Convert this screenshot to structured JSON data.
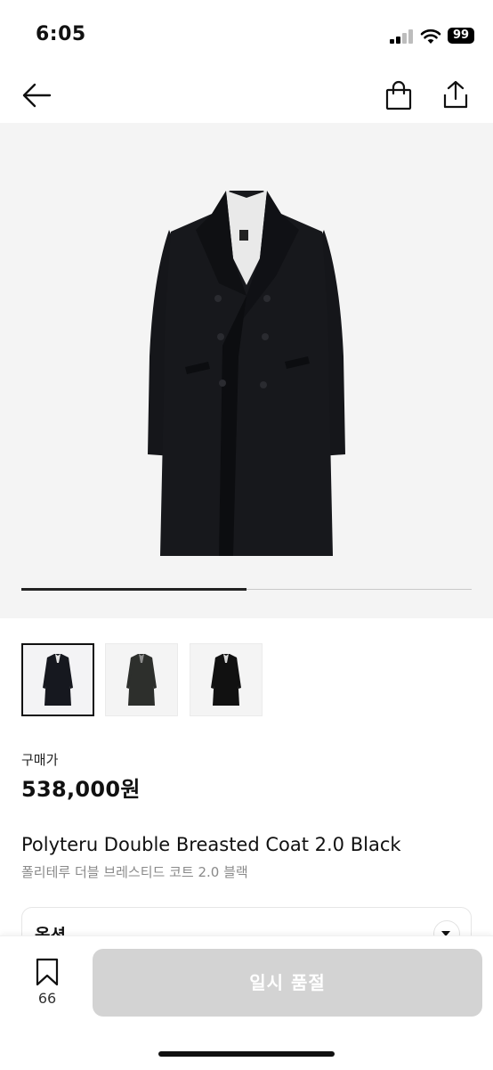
{
  "status_bar": {
    "time": "6:05",
    "battery": "99"
  },
  "nav": {
    "back_icon": "arrow-left-icon",
    "bag_icon": "shopping-bag-icon",
    "share_icon": "share-icon"
  },
  "hero": {
    "image": "black-double-breasted-coat",
    "carousel_progress": 0.5
  },
  "thumbnails": [
    {
      "image": "black-coat-front",
      "selected": true
    },
    {
      "image": "charcoal-coat-front",
      "selected": false
    },
    {
      "image": "black-coat-model",
      "selected": false
    }
  ],
  "price": {
    "label": "구매가",
    "value": "538,000원"
  },
  "product": {
    "title": "Polyteru Double Breasted Coat 2.0 Black",
    "subtitle": "폴리테루 더블 브레스티드 코트 2.0 블랙"
  },
  "options": {
    "label": "옵션",
    "icon": "chevron-down-icon"
  },
  "bottom_bar": {
    "wishlist_icon": "bookmark-icon",
    "wishlist_count": "66",
    "button_label": "일시 품절"
  },
  "colors": {
    "button_disabled": "#d3d3d3",
    "hero_bg": "#f4f4f4",
    "coat": "#15161a"
  }
}
